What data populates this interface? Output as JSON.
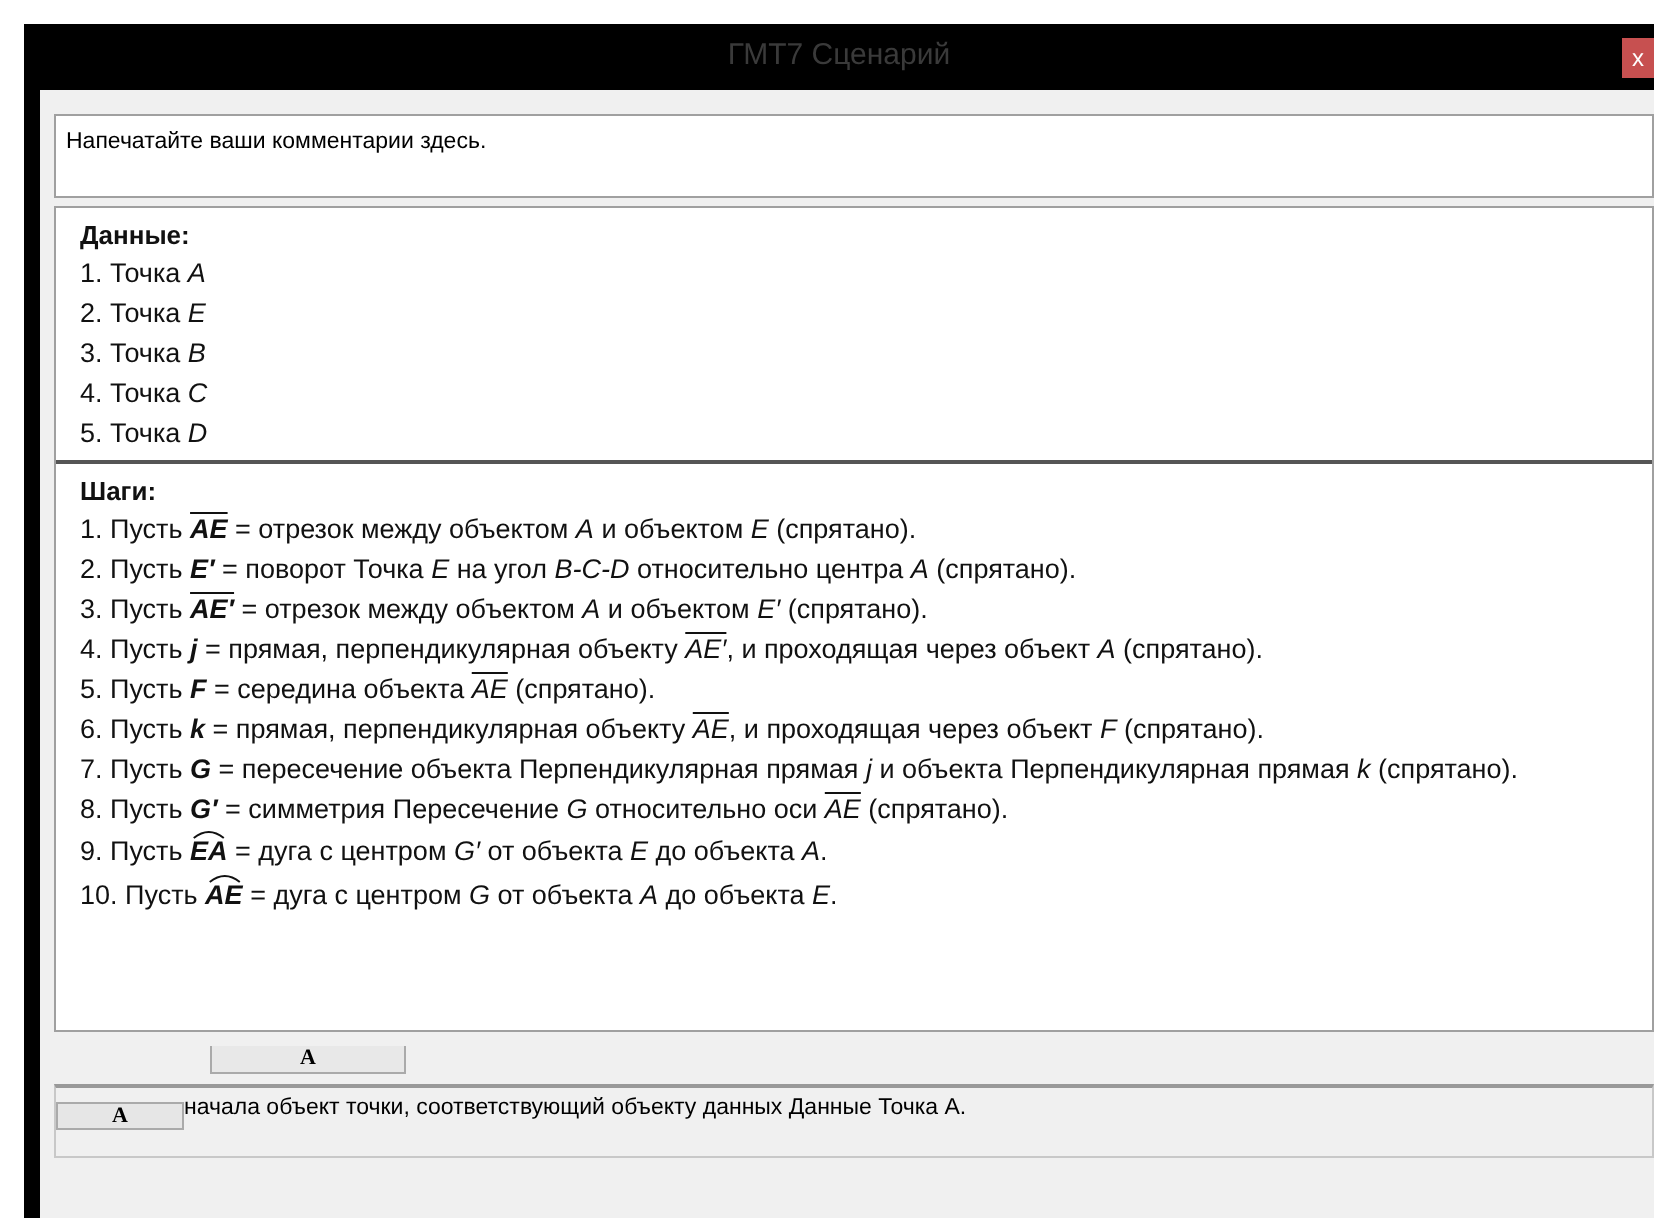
{
  "window": {
    "title": "ГМТ7 Сценарий",
    "close": "x"
  },
  "comment": {
    "value": "Напечатайте ваши комментарии здесь."
  },
  "given": {
    "heading": "Данные:",
    "items": [
      [
        {
          "kind": "text",
          "text": "1. Точка "
        },
        {
          "kind": "var",
          "text": "A"
        }
      ],
      [
        {
          "kind": "text",
          "text": "2. Точка "
        },
        {
          "kind": "var",
          "text": "E"
        }
      ],
      [
        {
          "kind": "text",
          "text": "3. Точка "
        },
        {
          "kind": "var",
          "text": "B"
        }
      ],
      [
        {
          "kind": "text",
          "text": "4. Точка "
        },
        {
          "kind": "var",
          "text": "C"
        }
      ],
      [
        {
          "kind": "text",
          "text": "5. Точка "
        },
        {
          "kind": "var",
          "text": "D"
        }
      ]
    ]
  },
  "steps": {
    "heading": "Шаги:",
    "items": [
      [
        {
          "kind": "text",
          "text": "1. Пусть "
        },
        {
          "kind": "seg",
          "text": "AE",
          "bold": true
        },
        {
          "kind": "text",
          "text": " = отрезок между объектом "
        },
        {
          "kind": "var",
          "text": "A"
        },
        {
          "kind": "text",
          "text": " и объектом "
        },
        {
          "kind": "var",
          "text": "E"
        },
        {
          "kind": "text",
          "text": " (спрятано)."
        }
      ],
      [
        {
          "kind": "text",
          "text": "2. Пусть "
        },
        {
          "kind": "var",
          "text": "E′",
          "bold": true
        },
        {
          "kind": "text",
          "text": " = поворот Точка "
        },
        {
          "kind": "var",
          "text": "E"
        },
        {
          "kind": "text",
          "text": " на угол "
        },
        {
          "kind": "var",
          "text": "B-C-D"
        },
        {
          "kind": "text",
          "text": " относительно центра "
        },
        {
          "kind": "var",
          "text": "A"
        },
        {
          "kind": "text",
          "text": " (спрятано)."
        }
      ],
      [
        {
          "kind": "text",
          "text": "3. Пусть "
        },
        {
          "kind": "seg",
          "text": "AE′",
          "bold": true
        },
        {
          "kind": "text",
          "text": " = отрезок между объектом "
        },
        {
          "kind": "var",
          "text": "A"
        },
        {
          "kind": "text",
          "text": " и объектом "
        },
        {
          "kind": "var",
          "text": "E′"
        },
        {
          "kind": "text",
          "text": " (спрятано)."
        }
      ],
      [
        {
          "kind": "text",
          "text": "4. Пусть "
        },
        {
          "kind": "var",
          "text": "j",
          "bold": true
        },
        {
          "kind": "text",
          "text": " = прямая, перпендикулярная объекту "
        },
        {
          "kind": "seg",
          "text": "AE′"
        },
        {
          "kind": "text",
          "text": ", и проходящая через объект "
        },
        {
          "kind": "var",
          "text": "A"
        },
        {
          "kind": "text",
          "text": " (спрятано)."
        }
      ],
      [
        {
          "kind": "text",
          "text": "5. Пусть "
        },
        {
          "kind": "var",
          "text": "F",
          "bold": true
        },
        {
          "kind": "text",
          "text": " = середина объекта "
        },
        {
          "kind": "seg",
          "text": "AE"
        },
        {
          "kind": "text",
          "text": " (спрятано)."
        }
      ],
      [
        {
          "kind": "text",
          "text": "6. Пусть "
        },
        {
          "kind": "var",
          "text": "k",
          "bold": true
        },
        {
          "kind": "text",
          "text": " = прямая, перпендикулярная объекту "
        },
        {
          "kind": "seg",
          "text": "AE"
        },
        {
          "kind": "text",
          "text": ", и проходящая через объект "
        },
        {
          "kind": "var",
          "text": "F"
        },
        {
          "kind": "text",
          "text": " (спрятано)."
        }
      ],
      [
        {
          "kind": "text",
          "text": "7. Пусть "
        },
        {
          "kind": "var",
          "text": "G",
          "bold": true
        },
        {
          "kind": "text",
          "text": " = пересечение объекта Перпендикулярная прямая "
        },
        {
          "kind": "var",
          "text": "j"
        },
        {
          "kind": "text",
          "text": " и объекта Перпендикулярная прямая "
        },
        {
          "kind": "var",
          "text": "k"
        },
        {
          "kind": "text",
          "text": " (спрятано)."
        }
      ],
      [
        {
          "kind": "text",
          "text": "8. Пусть "
        },
        {
          "kind": "var",
          "text": "G′",
          "bold": true
        },
        {
          "kind": "text",
          "text": " = симметрия Пересечение "
        },
        {
          "kind": "var",
          "text": "G"
        },
        {
          "kind": "text",
          "text": " относительно оси "
        },
        {
          "kind": "seg",
          "text": "AE"
        },
        {
          "kind": "text",
          "text": " (спрятано)."
        }
      ],
      [
        {
          "kind": "text",
          "text": "9. Пусть "
        },
        {
          "kind": "arc",
          "text": "EA",
          "bold": true
        },
        {
          "kind": "text",
          "text": " = дуга с центром "
        },
        {
          "kind": "var",
          "text": "G′"
        },
        {
          "kind": "text",
          "text": " от объекта "
        },
        {
          "kind": "var",
          "text": "E"
        },
        {
          "kind": "text",
          "text": " до объекта "
        },
        {
          "kind": "var",
          "text": "A"
        },
        {
          "kind": "text",
          "text": "."
        }
      ],
      [
        {
          "kind": "text",
          "text": "10. Пусть "
        },
        {
          "kind": "arc",
          "text": "AE",
          "bold": true
        },
        {
          "kind": "text",
          "text": " = дуга с центром "
        },
        {
          "kind": "var",
          "text": "G"
        },
        {
          "kind": "text",
          "text": " от объекта "
        },
        {
          "kind": "var",
          "text": "A"
        },
        {
          "kind": "text",
          "text": " до объекта "
        },
        {
          "kind": "var",
          "text": "E"
        },
        {
          "kind": "text",
          "text": "."
        }
      ]
    ]
  },
  "tab_button": {
    "label": "A"
  },
  "status": {
    "button": "A",
    "text": "начала объект точки, соответствующий объекту данных Данные Точка А."
  }
}
